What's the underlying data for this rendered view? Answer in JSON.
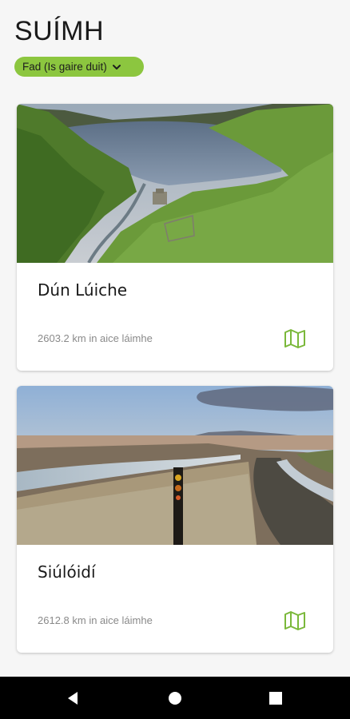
{
  "header": {
    "title": "SUÍMH"
  },
  "sort": {
    "label": "Fad (Is gaire duit)"
  },
  "sites": [
    {
      "name": "Dún Lúiche",
      "distance": "2603.2 km in aice láimhe"
    },
    {
      "name": "Siúlóidí",
      "distance": "2612.8 km in aice láimhe"
    }
  ],
  "icons": {
    "sort": "chevron-down-icon",
    "map": "map-icon",
    "back": "back-triangle-icon",
    "home": "home-circle-icon",
    "recent": "recent-square-icon"
  },
  "colors": {
    "accent": "#8cc63f",
    "background": "#f6f6f6",
    "navbar": "#000000"
  }
}
